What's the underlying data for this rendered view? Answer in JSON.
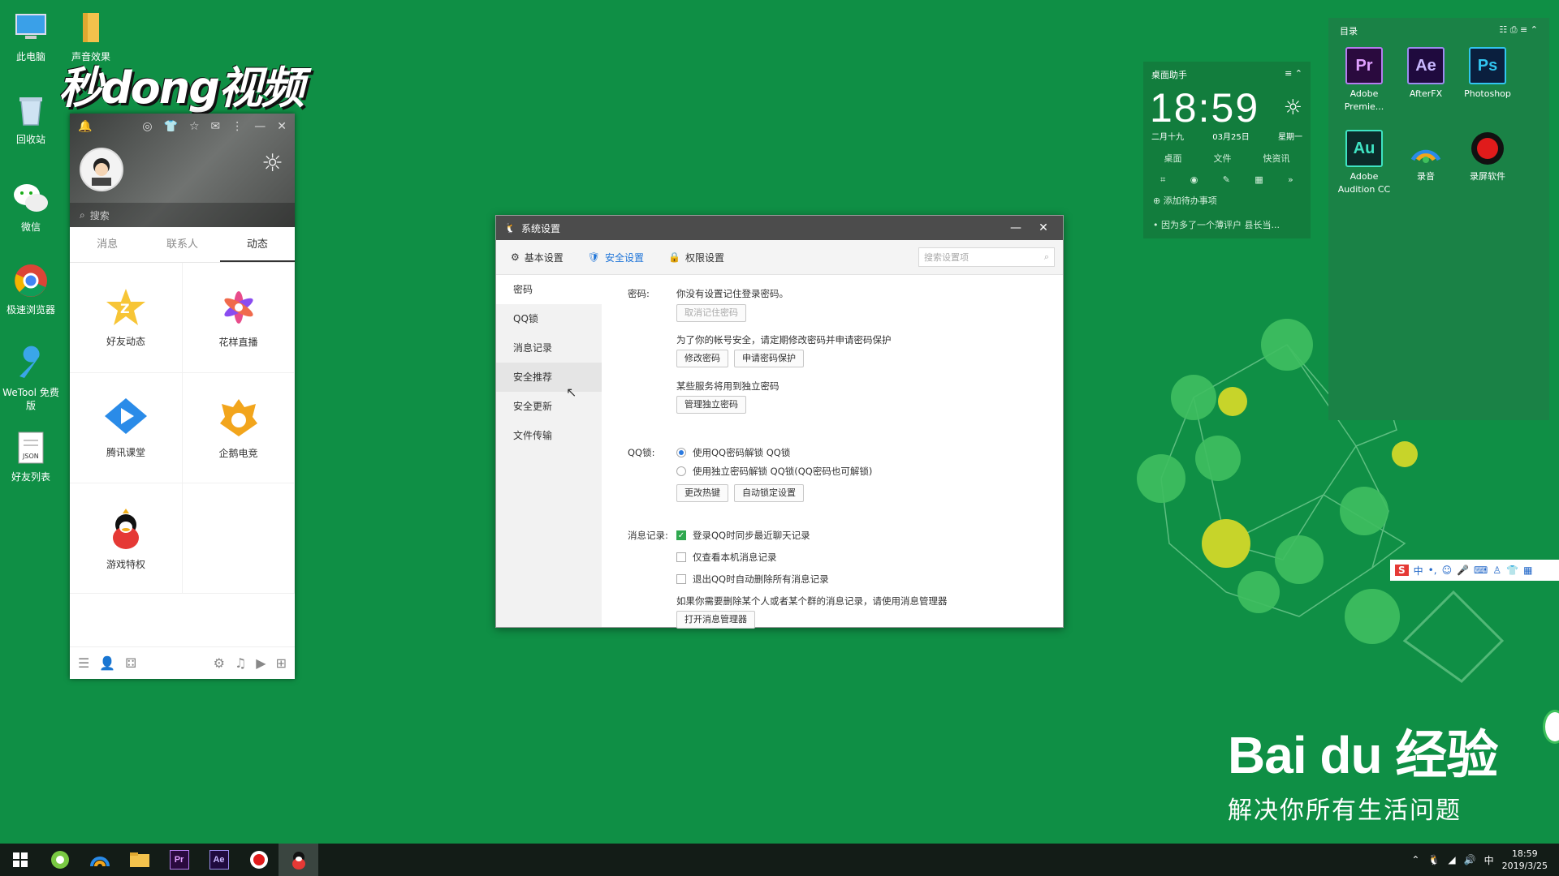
{
  "desktop": {
    "icons": [
      {
        "label": "此电脑"
      },
      {
        "label": "声音效果"
      },
      {
        "label": "回收站"
      },
      {
        "label": "微信"
      },
      {
        "label": "极速浏览器"
      },
      {
        "label": "WeTool 免费版"
      },
      {
        "label": "好友列表"
      }
    ],
    "watermark": "秒dong视频",
    "baidu_logo": "Bai du 经验",
    "baidu_slogan": "解决你所有生活问题"
  },
  "qq": {
    "search_placeholder": "搜索",
    "tabs": [
      {
        "label": "消息"
      },
      {
        "label": "联系人"
      },
      {
        "label": "动态",
        "active": true
      }
    ],
    "grid": [
      {
        "label": "好友动态",
        "icon": "star-z-icon"
      },
      {
        "label": "花样直播",
        "icon": "flower-icon"
      },
      {
        "label": "腾讯课堂",
        "icon": "play-diamond-icon"
      },
      {
        "label": "企鹅电竞",
        "icon": "shield-crown-icon"
      },
      {
        "label": "游戏特权",
        "icon": "penguin-icon"
      }
    ]
  },
  "settings": {
    "title": "系统设置",
    "nav": [
      {
        "label": "基本设置",
        "icon": "gear-icon"
      },
      {
        "label": "安全设置",
        "icon": "shield-icon",
        "active": true
      },
      {
        "label": "权限设置",
        "icon": "lock-icon"
      }
    ],
    "search_placeholder": "搜索设置项",
    "sidebar": [
      {
        "label": "密码"
      },
      {
        "label": "QQ锁"
      },
      {
        "label": "消息记录"
      },
      {
        "label": "安全推荐"
      },
      {
        "label": "安全更新"
      },
      {
        "label": "文件传输"
      }
    ],
    "password": {
      "label": "密码:",
      "status": "你没有设置记住登录密码。",
      "forget_button": "取消记住密码",
      "tip": "为了你的帐号安全，请定期修改密码并申请密码保护",
      "change_button": "修改密码",
      "protect_button": "申请密码保护",
      "independent_tip": "某些服务将用到独立密码",
      "independent_button": "管理独立密码"
    },
    "qqlock": {
      "label": "QQ锁:",
      "option1": "使用QQ密码解锁 QQ锁",
      "option2": "使用独立密码解锁 QQ锁(QQ密码也可解锁)",
      "hotkey_button": "更改热键",
      "autolock_button": "自动锁定设置"
    },
    "history": {
      "label": "消息记录:",
      "check1": "登录QQ时同步最近聊天记录",
      "check2": "仅查看本机消息记录",
      "check3": "退出QQ时自动删除所有消息记录",
      "tip": "如果你需要删除某个人或者某个群的消息记录，请使用消息管理器",
      "open_button": "打开消息管理器"
    }
  },
  "clock_widget": {
    "title": "桌面助手",
    "time": "18:59",
    "lunar": "二月十九",
    "date": "03月25日",
    "weekday": "星期一",
    "links": [
      {
        "label": "桌面"
      },
      {
        "label": "文件"
      },
      {
        "label": "快资讯"
      }
    ],
    "todo": "添加待办事项",
    "news": "• 因为多了一个薄评户 县长当..."
  },
  "folder": {
    "title": "目录",
    "apps": [
      {
        "label": "Adobe Premie...",
        "abbr": "Pr",
        "color": "#2a0a3e",
        "fg": "#e0a0ff"
      },
      {
        "label": "AfterFX",
        "abbr": "Ae",
        "color": "#1f0a3e",
        "fg": "#c8b8ff"
      },
      {
        "label": "Photoshop",
        "abbr": "Ps",
        "color": "#0a1f3e",
        "fg": "#31c5f0"
      },
      {
        "label": "Adobe Audition CC",
        "abbr": "Au",
        "color": "#0b2b2a",
        "fg": "#3fe3c3"
      },
      {
        "label": "录音",
        "abbr": "",
        "color": "transparent",
        "fg": "#fff"
      },
      {
        "label": "录屏软件",
        "abbr": "",
        "color": "transparent",
        "fg": "#fff"
      }
    ]
  },
  "taskbar": {
    "time": "18:59",
    "date": "2019/3/25",
    "ime": "中"
  }
}
